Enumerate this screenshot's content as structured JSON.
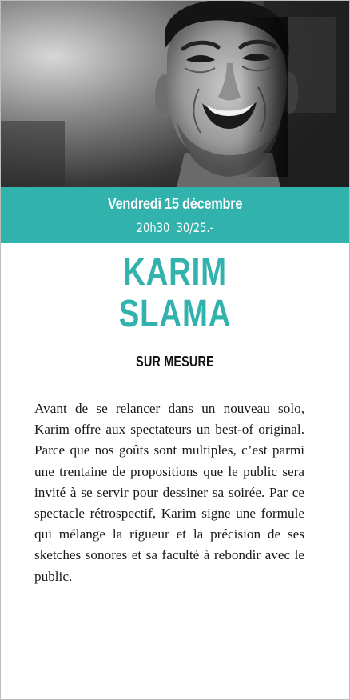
{
  "event": {
    "date": "Vendredi 15 décembre",
    "time": "20h30",
    "price": "30/25.-"
  },
  "artist": {
    "first_name": "KARIM",
    "last_name": "SLAMA"
  },
  "show": {
    "title": "SUR MESURE"
  },
  "description": "Avant de se relancer dans un nouveau solo, Karim offre aux spectateurs un best-of original. Parce que nos goûts sont mul­tiples, c’est parmi une trentaine de propo­sitions que le public sera invité à se servir pour dessiner sa soirée. Par ce spectacle rétrospectif, Karim signe une formule qui mélange la rigueur et la précision de ses sketches sonores et sa faculté à rebondir avec le public.",
  "colors": {
    "accent": "#31b2ad",
    "text": "#1a1a1a",
    "border": "#bdbdbd"
  },
  "photo": {
    "style": "black-and-white"
  }
}
